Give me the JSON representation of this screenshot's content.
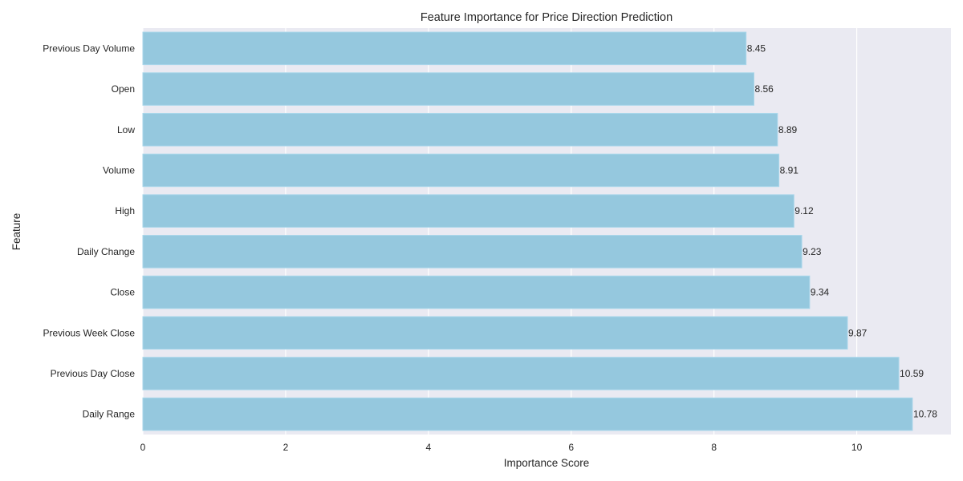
{
  "chart_data": {
    "type": "bar",
    "orientation": "horizontal",
    "title": "Feature Importance for Price Direction Prediction",
    "xlabel": "Importance Score",
    "ylabel": "Feature",
    "categories": [
      "Previous Day Volume",
      "Open",
      "Low",
      "Volume",
      "High",
      "Daily Change",
      "Close",
      "Previous Week Close",
      "Previous Day Close",
      "Daily Range"
    ],
    "values": [
      8.45,
      8.56,
      8.89,
      8.91,
      9.12,
      9.23,
      9.34,
      9.87,
      10.59,
      10.78
    ],
    "data_labels": [
      "8.45",
      "8.56",
      "8.89",
      "8.91",
      "9.12",
      "9.23",
      "9.34",
      "9.87",
      "10.59",
      "10.78"
    ],
    "xlim": [
      0,
      11.32
    ],
    "xticks": [
      0,
      2,
      4,
      6,
      8,
      10
    ],
    "xtick_labels": [
      "0",
      "2",
      "4",
      "6",
      "8",
      "10"
    ],
    "grid": true,
    "legend": "none",
    "colors": {
      "bar": "#95c8de",
      "bar_edge": "#a9d6ea",
      "plot_background": "#eaeaf2",
      "grid": "#ffffff",
      "text": "#262626"
    }
  }
}
